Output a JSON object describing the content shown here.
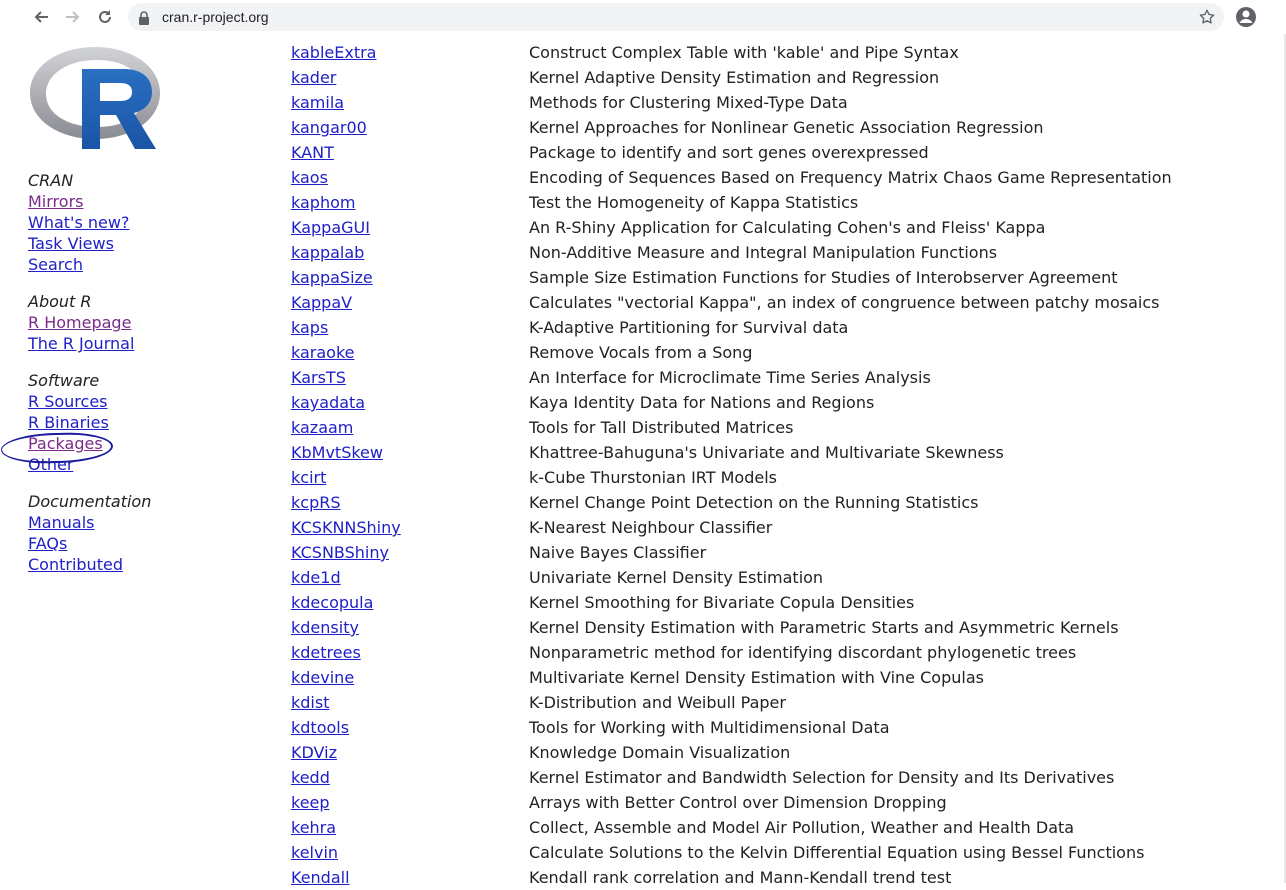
{
  "browser": {
    "url": "cran.r-project.org"
  },
  "sidebar": {
    "sections": [
      {
        "heading": "CRAN",
        "links": [
          {
            "label": "Mirrors",
            "visited": true
          },
          {
            "label": "What's new?",
            "visited": false
          },
          {
            "label": "Task Views",
            "visited": false
          },
          {
            "label": "Search",
            "visited": false
          }
        ]
      },
      {
        "heading": "About R",
        "links": [
          {
            "label": "R Homepage",
            "visited": true
          },
          {
            "label": "The R Journal",
            "visited": false
          }
        ]
      },
      {
        "heading": "Software",
        "links": [
          {
            "label": "R Sources",
            "visited": false
          },
          {
            "label": "R Binaries",
            "visited": false
          },
          {
            "label": "Packages",
            "visited": true
          },
          {
            "label": "Other",
            "visited": false
          }
        ]
      },
      {
        "heading": "Documentation",
        "links": [
          {
            "label": "Manuals",
            "visited": false
          },
          {
            "label": "FAQs",
            "visited": false
          },
          {
            "label": "Contributed",
            "visited": false
          }
        ]
      }
    ]
  },
  "packages": [
    {
      "name": "kableExtra",
      "desc": "Construct Complex Table with 'kable' and Pipe Syntax"
    },
    {
      "name": "kader",
      "desc": "Kernel Adaptive Density Estimation and Regression"
    },
    {
      "name": "kamila",
      "desc": "Methods for Clustering Mixed-Type Data"
    },
    {
      "name": "kangar00",
      "desc": "Kernel Approaches for Nonlinear Genetic Association Regression"
    },
    {
      "name": "KANT",
      "desc": "Package to identify and sort genes overexpressed"
    },
    {
      "name": "kaos",
      "desc": "Encoding of Sequences Based on Frequency Matrix Chaos Game Representation"
    },
    {
      "name": "kaphom",
      "desc": "Test the Homogeneity of Kappa Statistics"
    },
    {
      "name": "KappaGUI",
      "desc": "An R-Shiny Application for Calculating Cohen's and Fleiss' Kappa"
    },
    {
      "name": "kappalab",
      "desc": "Non-Additive Measure and Integral Manipulation Functions"
    },
    {
      "name": "kappaSize",
      "desc": "Sample Size Estimation Functions for Studies of Interobserver Agreement"
    },
    {
      "name": "KappaV",
      "desc": "Calculates \"vectorial Kappa\", an index of congruence between patchy mosaics"
    },
    {
      "name": "kaps",
      "desc": "K-Adaptive Partitioning for Survival data"
    },
    {
      "name": "karaoke",
      "desc": "Remove Vocals from a Song"
    },
    {
      "name": "KarsTS",
      "desc": "An Interface for Microclimate Time Series Analysis"
    },
    {
      "name": "kayadata",
      "desc": "Kaya Identity Data for Nations and Regions"
    },
    {
      "name": "kazaam",
      "desc": "Tools for Tall Distributed Matrices"
    },
    {
      "name": "KbMvtSkew",
      "desc": "Khattree-Bahuguna's Univariate and Multivariate Skewness"
    },
    {
      "name": "kcirt",
      "desc": "k-Cube Thurstonian IRT Models"
    },
    {
      "name": "kcpRS",
      "desc": "Kernel Change Point Detection on the Running Statistics"
    },
    {
      "name": "KCSKNNShiny",
      "desc": "K-Nearest Neighbour Classifier"
    },
    {
      "name": "KCSNBShiny",
      "desc": "Naive Bayes Classifier"
    },
    {
      "name": "kde1d",
      "desc": "Univariate Kernel Density Estimation"
    },
    {
      "name": "kdecopula",
      "desc": "Kernel Smoothing for Bivariate Copula Densities"
    },
    {
      "name": "kdensity",
      "desc": "Kernel Density Estimation with Parametric Starts and Asymmetric Kernels"
    },
    {
      "name": "kdetrees",
      "desc": "Nonparametric method for identifying discordant phylogenetic trees"
    },
    {
      "name": "kdevine",
      "desc": "Multivariate Kernel Density Estimation with Vine Copulas"
    },
    {
      "name": "kdist",
      "desc": "K-Distribution and Weibull Paper"
    },
    {
      "name": "kdtools",
      "desc": "Tools for Working with Multidimensional Data"
    },
    {
      "name": "KDViz",
      "desc": "Knowledge Domain Visualization"
    },
    {
      "name": "kedd",
      "desc": "Kernel Estimator and Bandwidth Selection for Density and Its Derivatives"
    },
    {
      "name": "keep",
      "desc": "Arrays with Better Control over Dimension Dropping"
    },
    {
      "name": "kehra",
      "desc": "Collect, Assemble and Model Air Pollution, Weather and Health Data"
    },
    {
      "name": "kelvin",
      "desc": "Calculate Solutions to the Kelvin Differential Equation using Bessel Functions"
    },
    {
      "name": "Kendall",
      "desc": "Kendall rank correlation and Mann-Kendall trend test"
    }
  ]
}
